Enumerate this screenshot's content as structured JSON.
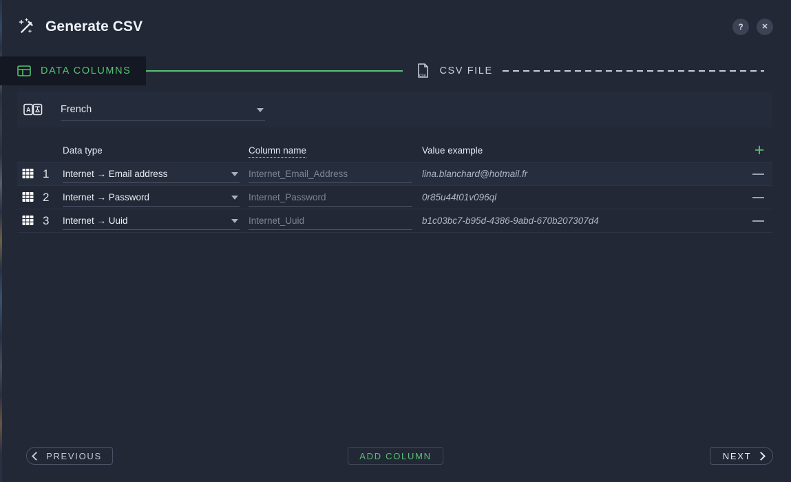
{
  "window": {
    "title": "Generate CSV",
    "title_icon": "magic-wand-icon",
    "help_label": "?",
    "close_label": "✕"
  },
  "steps": [
    {
      "label": "DATA COLUMNS",
      "icon": "layout-panel-icon",
      "state": "active"
    },
    {
      "label": "CSV FILE",
      "icon": "csv-file-icon",
      "state": "inactive"
    }
  ],
  "language": {
    "icon": "translate-icon",
    "value": "French",
    "caret": "chevron-down-icon"
  },
  "table": {
    "headers": {
      "data_type": "Data type",
      "column_name": "Column name",
      "value_example": "Value example"
    },
    "add_row_label": "+",
    "rows": [
      {
        "index": "1",
        "data_type": "Internet → Email address",
        "column_name_placeholder": "Internet_Email_Address",
        "value_example": "lina.blanchard@hotmail.fr",
        "remove_label": "−"
      },
      {
        "index": "2",
        "data_type": "Internet → Password",
        "column_name_placeholder": "Internet_Password",
        "value_example": "0r85u44t01v096ql",
        "remove_label": "−"
      },
      {
        "index": "3",
        "data_type": "Internet → Uuid",
        "column_name_placeholder": "Internet_Uuid",
        "value_example": "b1c03bc7-b95d-4386-9abd-670b207307d4",
        "remove_label": "−"
      }
    ]
  },
  "footer": {
    "previous": "PREVIOUS",
    "add_column": "ADD COLUMN",
    "next": "NEXT"
  },
  "colors": {
    "accent_green": "#56c271",
    "window_bg": "#222836",
    "panel_bg": "#242b3a",
    "active_tab_bg": "#131823",
    "text_primary": "#e6eaf1",
    "text_muted": "#7d8696"
  }
}
